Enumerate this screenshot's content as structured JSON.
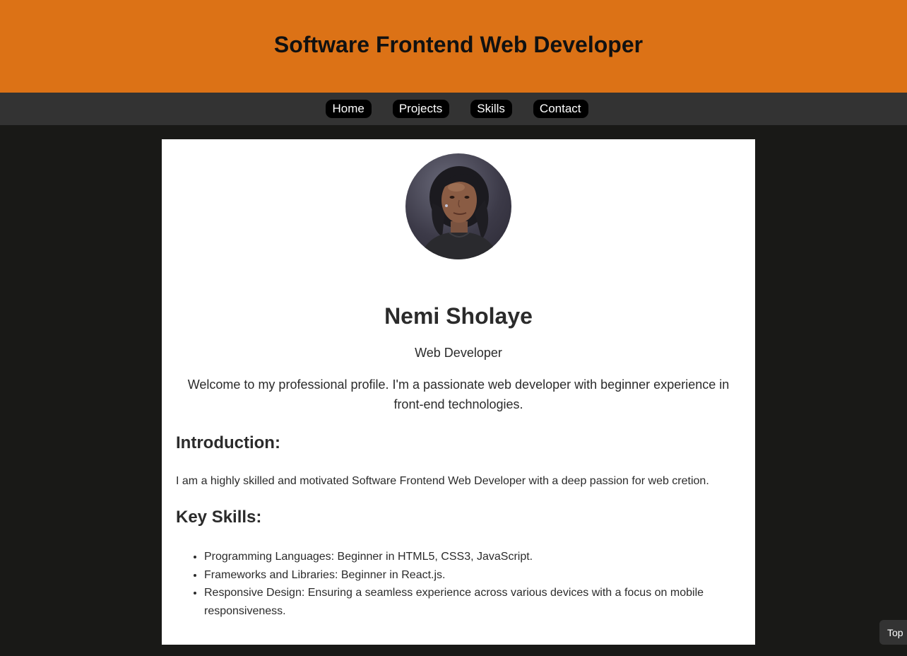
{
  "header": {
    "title": "Software Frontend Web Developer"
  },
  "nav": {
    "items": [
      {
        "label": "Home"
      },
      {
        "label": "Projects"
      },
      {
        "label": "Skills"
      },
      {
        "label": "Contact"
      }
    ]
  },
  "profile": {
    "name": "Nemi Sholaye",
    "role": "Web Developer",
    "welcome": "Welcome to my professional profile. I'm a passionate web developer with beginner experience in front-end technologies."
  },
  "introduction": {
    "heading": "Introduction:",
    "text": "I am a highly skilled and motivated Software Frontend Web Developer with a deep passion for web cretion."
  },
  "skills": {
    "heading": "Key Skills:",
    "items": [
      "Programming Languages: Beginner in HTML5, CSS3, JavaScript.",
      "Frameworks and Libraries: Beginner in React.js.",
      "Responsive Design: Ensuring a seamless experience across various devices with a focus on mobile responsiveness."
    ]
  },
  "back_to_top": {
    "label": "Top"
  },
  "colors": {
    "header_bg": "#dc7216",
    "nav_bg": "#333333",
    "page_bg": "#191917",
    "card_bg": "#ffffff",
    "text": "#2b2b2b"
  }
}
